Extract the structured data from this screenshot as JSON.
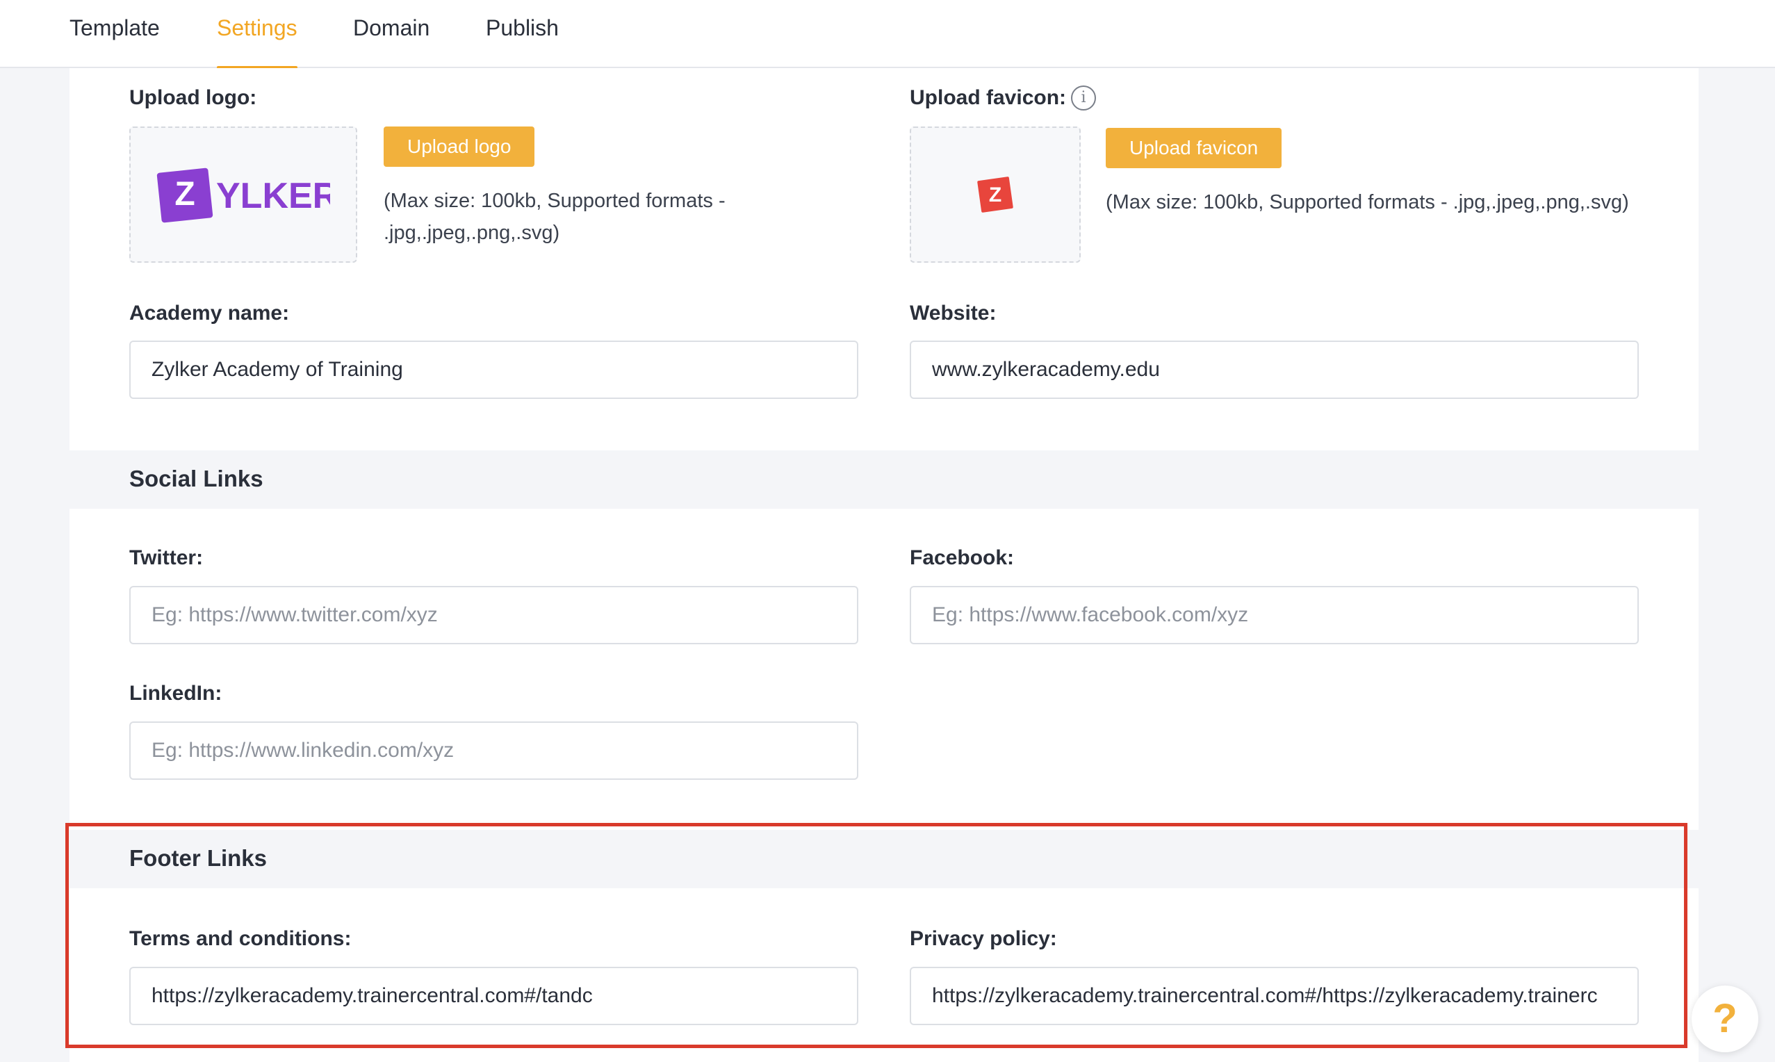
{
  "tabs": [
    {
      "label": "Template"
    },
    {
      "label": "Settings",
      "active": true
    },
    {
      "label": "Domain"
    },
    {
      "label": "Publish"
    }
  ],
  "branding": {
    "upload_logo_label": "Upload logo:",
    "upload_logo_button": "Upload logo",
    "logo_hint": "(Max size: 100kb, Supported formats - .jpg,.jpeg,.png,.svg)",
    "logo_letter": "Z",
    "logo_text": "YLKER",
    "logo_color": "#8a3fd1",
    "upload_favicon_label": "Upload favicon:",
    "upload_favicon_button": "Upload favicon",
    "favicon_hint": "(Max size: 100kb, Supported formats - .jpg,.jpeg,.png,.svg)",
    "favicon_letter": "Z",
    "favicon_color": "#e8453c",
    "info_icon": "i"
  },
  "fields": {
    "academy_name_label": "Academy name:",
    "academy_name_value": "Zylker Academy of Training",
    "website_label": "Website:",
    "website_value": "www.zylkeracademy.edu"
  },
  "social": {
    "title": "Social Links",
    "twitter_label": "Twitter:",
    "twitter_placeholder": "Eg: https://www.twitter.com/xyz",
    "facebook_label": "Facebook:",
    "facebook_placeholder": "Eg: https://www.facebook.com/xyz",
    "linkedin_label": "LinkedIn:",
    "linkedin_placeholder": "Eg: https://www.linkedin.com/xyz"
  },
  "footer": {
    "title": "Footer Links",
    "terms_label": "Terms and conditions:",
    "terms_value": "https://zylkeracademy.trainercentral.com#/tandc",
    "privacy_label": "Privacy policy:",
    "privacy_value": "https://zylkeracademy.trainercentral.com#/https://zylkeracademy.trainerc"
  },
  "help": {
    "label": "?"
  },
  "colors": {
    "accent": "#f2a623",
    "button": "#f2b13c",
    "highlight": "#d93a2b"
  }
}
